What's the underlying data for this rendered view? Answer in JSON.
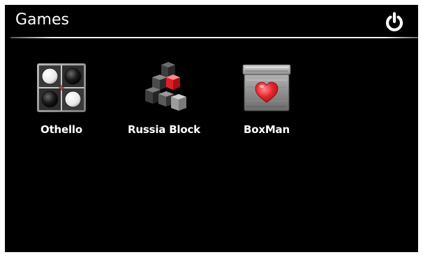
{
  "header": {
    "title": "Games"
  },
  "icons": {
    "power": "power-icon",
    "othello": "othello-board-icon",
    "russia_block": "stacked-blocks-icon",
    "boxman": "heart-crate-icon"
  },
  "colors": {
    "background": "#000000",
    "text": "#ffffff",
    "accent_red": "#e8242c"
  },
  "games": [
    {
      "label": "Othello"
    },
    {
      "label": "Russia Block"
    },
    {
      "label": "BoxMan"
    }
  ]
}
